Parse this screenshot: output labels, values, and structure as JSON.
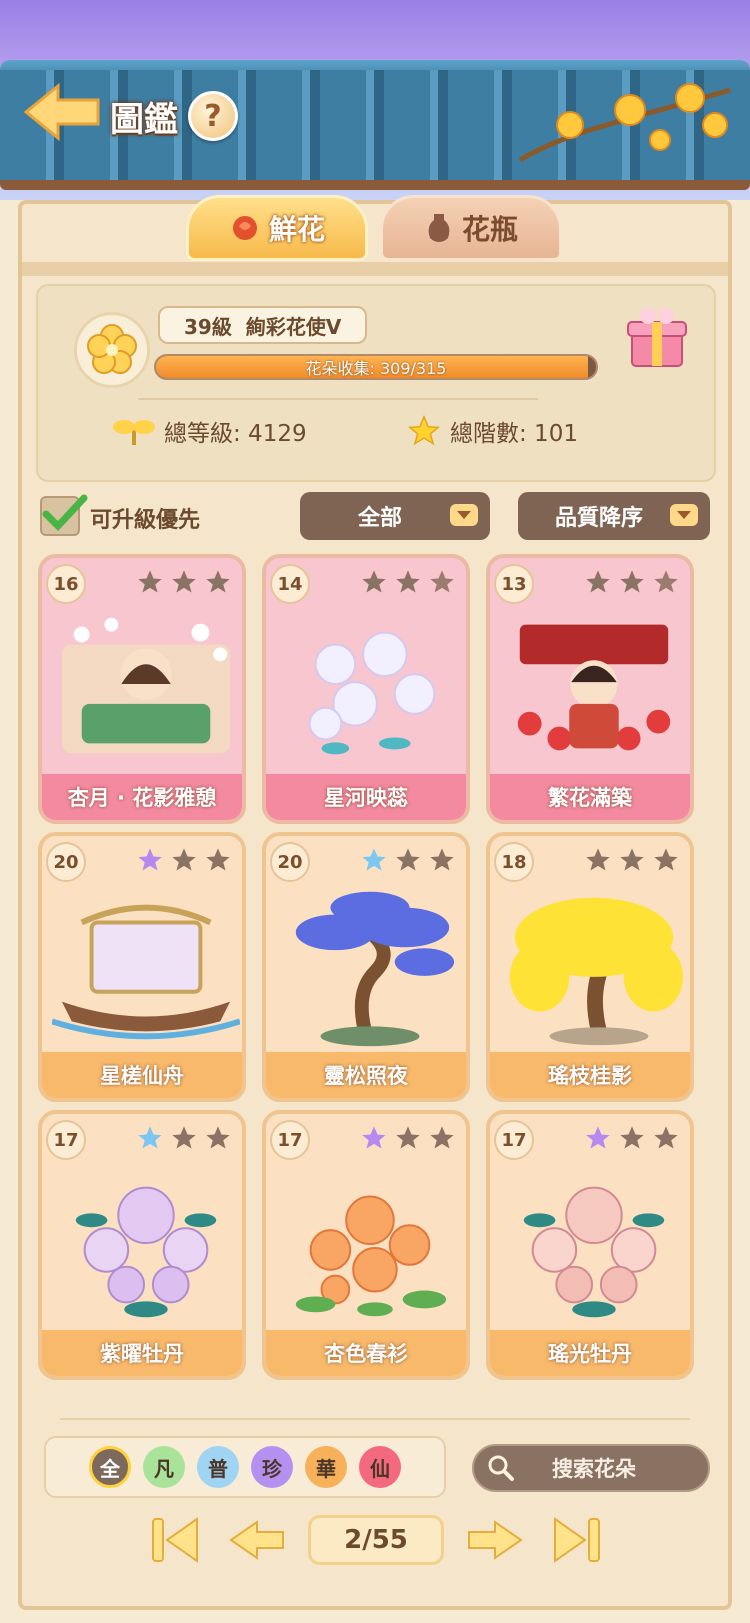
{
  "header": {
    "title": "圖鑑",
    "help_label": "?"
  },
  "tabs": [
    {
      "label": "鮮花",
      "active": true
    },
    {
      "label": "花瓶",
      "active": false
    }
  ],
  "profile": {
    "level": "39級",
    "rank_title": "絢彩花使Ⅴ",
    "collection_text": "花朵收集: 309/315",
    "collected": 309,
    "collection_total": 315,
    "total_level": "總等級: 4129",
    "total_stars": "總階數: 101"
  },
  "filters": {
    "upgrade_first_label": "可升級優先",
    "upgrade_first_checked": true,
    "category": "全部",
    "sort": "品質降序"
  },
  "cards": [
    {
      "level": "16",
      "name": "杏月 · 花影雅憩",
      "theme": "pink",
      "stars": [
        "gray",
        "gray",
        "gray"
      ],
      "art": "scene-lady"
    },
    {
      "level": "14",
      "name": "星河映蕊",
      "theme": "pink",
      "stars": [
        "gray",
        "gray",
        "dim"
      ],
      "art": "white-roses"
    },
    {
      "level": "13",
      "name": "繁花滿築",
      "theme": "pink",
      "stars": [
        "gray",
        "gray",
        "dim"
      ],
      "art": "scene-girl"
    },
    {
      "level": "20",
      "name": "星槎仙舟",
      "theme": "orange",
      "stars": [
        "purple",
        "gray",
        "gray"
      ],
      "art": "boat"
    },
    {
      "level": "20",
      "name": "靈松照夜",
      "theme": "orange",
      "stars": [
        "blue",
        "gray",
        "gray"
      ],
      "art": "blue-pine"
    },
    {
      "level": "18",
      "name": "瑤枝桂影",
      "theme": "orange",
      "stars": [
        "gray",
        "gray",
        "gray"
      ],
      "art": "yellow-tree"
    },
    {
      "level": "17",
      "name": "紫曜牡丹",
      "theme": "orange",
      "stars": [
        "blue",
        "gray",
        "gray"
      ],
      "art": "purple-peony"
    },
    {
      "level": "17",
      "name": "杏色春衫",
      "theme": "orange",
      "stars": [
        "purple",
        "gray",
        "gray"
      ],
      "art": "orange-lotus"
    },
    {
      "level": "17",
      "name": "瑤光牡丹",
      "theme": "orange",
      "stars": [
        "purple",
        "gray",
        "gray"
      ],
      "art": "pink-peony"
    }
  ],
  "quality_filters": [
    {
      "label": "全",
      "color": "#7d6a5d",
      "selected": true
    },
    {
      "label": "凡",
      "color": "#a9e39a",
      "selected": false
    },
    {
      "label": "普",
      "color": "#9fd4f2",
      "selected": false
    },
    {
      "label": "珍",
      "color": "#b690f0",
      "selected": false
    },
    {
      "label": "華",
      "color": "#f6b15a",
      "selected": false
    },
    {
      "label": "仙",
      "color": "#f36a7e",
      "selected": false
    }
  ],
  "search": {
    "placeholder": "搜索花朵"
  },
  "pagination": {
    "current": 2,
    "total": 55,
    "text": "2/55"
  },
  "colors": {
    "accent": "#f7b94b",
    "card_pink": "#f38a9f",
    "card_orange": "#f8b96b",
    "dark_button": "#7f6454"
  }
}
